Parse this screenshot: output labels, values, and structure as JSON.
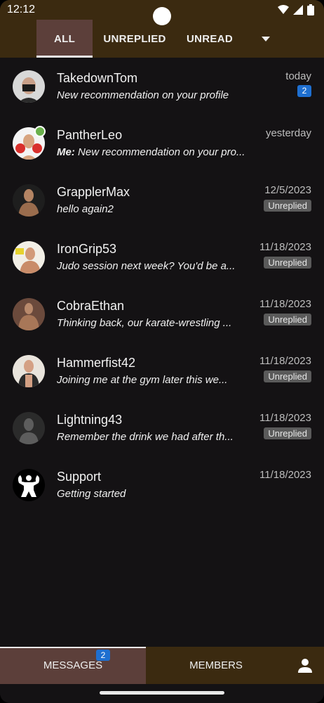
{
  "status_bar": {
    "time": "12:12"
  },
  "tabs": [
    {
      "label": "ALL",
      "active": true
    },
    {
      "label": "UNREPLIED",
      "active": false
    },
    {
      "label": "UNREAD",
      "active": false
    }
  ],
  "conversations": [
    {
      "name": "TakedownTom",
      "message": "New recommendation on your profile",
      "prefix": "",
      "date": "today",
      "unread_count": "2",
      "status_badge": ""
    },
    {
      "name": "PantherLeo",
      "message": "New recommendation on your pro...",
      "prefix": "Me:",
      "date": "yesterday",
      "unread_count": "",
      "status_badge": "",
      "online": true
    },
    {
      "name": "GrapplerMax",
      "message": "hello again2",
      "prefix": "",
      "date": "12/5/2023",
      "unread_count": "",
      "status_badge": "Unreplied"
    },
    {
      "name": "IronGrip53",
      "message": "Judo session next week? You'd be a...",
      "prefix": "",
      "date": "11/18/2023",
      "unread_count": "",
      "status_badge": "Unreplied"
    },
    {
      "name": "CobraEthan",
      "message": "Thinking back, our karate-wrestling ...",
      "prefix": "",
      "date": "11/18/2023",
      "unread_count": "",
      "status_badge": "Unreplied"
    },
    {
      "name": "Hammerfist42",
      "message": "Joining me at the gym later this we...",
      "prefix": "",
      "date": "11/18/2023",
      "unread_count": "",
      "status_badge": "Unreplied"
    },
    {
      "name": "Lightning43",
      "message": "Remember the drink we had after th...",
      "prefix": "",
      "date": "11/18/2023",
      "unread_count": "",
      "status_badge": "Unreplied"
    },
    {
      "name": "Support",
      "message": "Getting started",
      "prefix": "",
      "date": "11/18/2023",
      "unread_count": "",
      "status_badge": ""
    }
  ],
  "bottom_nav": {
    "messages_label": "MESSAGES",
    "messages_badge": "2",
    "members_label": "MEMBERS"
  },
  "colors": {
    "header_bg": "#3b2a10",
    "active_tab_bg": "#5c3f3a",
    "list_bg": "#141214",
    "badge_blue": "#1e6fd0",
    "online_green": "#6ab04c"
  }
}
